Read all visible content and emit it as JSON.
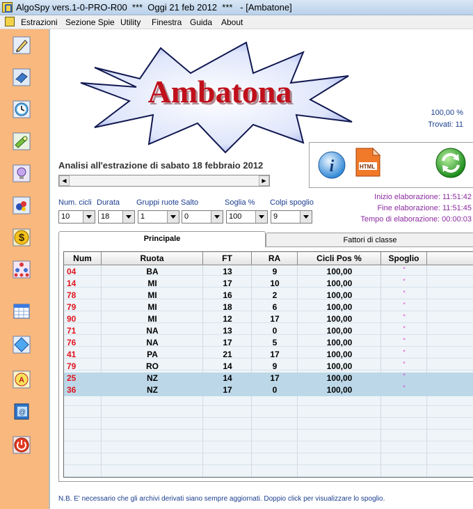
{
  "window": {
    "title": "AlgoSpy vers.1-0-PRO-R00  ***  Oggi 21 feb 2012  ***   - [Ambatone]"
  },
  "menu": [
    "Estrazioni",
    "Sezione Spie",
    "Utility",
    "Finestra",
    "Guida",
    "About"
  ],
  "sidebar": {
    "buttons": [
      "pencil-icon",
      "eraser-icon",
      "clock-icon",
      "flashlight-icon",
      "lightbulb-icon",
      "lottery-balls-icon",
      "dollar-icon",
      "tree-diagram-icon",
      "calendar-icon",
      "diamond-icon",
      "letter-a-icon",
      "address-book-icon",
      "power-icon"
    ]
  },
  "banner": {
    "text": "Ambatona"
  },
  "stats": {
    "percent": "100,00 %",
    "found": "Trovati: 11"
  },
  "analysis": {
    "title": "Analisi all'estrazione di sabato 18 febbraio 2012"
  },
  "actions": {
    "info": "info-icon",
    "html": "HTML",
    "refresh": "refresh-icon"
  },
  "timing": {
    "start": "Inizio elaborazione: 11:51:42",
    "end": "Fine elaborazione: 11:51:45",
    "elapsed": "Tempo di elaborazione: 00:00:03"
  },
  "fields": {
    "num_cicli": {
      "label": "Num. cicli",
      "value": "10"
    },
    "durata": {
      "label": "Durata",
      "value": "18"
    },
    "gruppi_ruote": {
      "label": "Gruppi ruote",
      "value": "1"
    },
    "salto": {
      "label": "Salto",
      "value": "0"
    },
    "soglia": {
      "label": "Soglia %",
      "value": "100"
    },
    "colpi_spoglio": {
      "label": "Colpi spoglio",
      "value": "9"
    }
  },
  "tabs": [
    "Principale",
    "Fattori di classe"
  ],
  "grid": {
    "columns": [
      "Num",
      "Ruota",
      "FT",
      "RA",
      "Cicli Pos %",
      "Spoglio"
    ],
    "rows": [
      {
        "num": "04",
        "ruota": "BA",
        "ft": "13",
        "ra": "9",
        "cicli": "100,00",
        "spoglio": "°"
      },
      {
        "num": "14",
        "ruota": "MI",
        "ft": "17",
        "ra": "10",
        "cicli": "100,00",
        "spoglio": "°"
      },
      {
        "num": "78",
        "ruota": "MI",
        "ft": "16",
        "ra": "2",
        "cicli": "100,00",
        "spoglio": "°"
      },
      {
        "num": "79",
        "ruota": "MI",
        "ft": "18",
        "ra": "6",
        "cicli": "100,00",
        "spoglio": "°"
      },
      {
        "num": "90",
        "ruota": "MI",
        "ft": "12",
        "ra": "17",
        "cicli": "100,00",
        "spoglio": "°"
      },
      {
        "num": "71",
        "ruota": "NA",
        "ft": "13",
        "ra": "0",
        "cicli": "100,00",
        "spoglio": "°"
      },
      {
        "num": "76",
        "ruota": "NA",
        "ft": "17",
        "ra": "5",
        "cicli": "100,00",
        "spoglio": "°"
      },
      {
        "num": "41",
        "ruota": "PA",
        "ft": "21",
        "ra": "17",
        "cicli": "100,00",
        "spoglio": "°"
      },
      {
        "num": "79",
        "ruota": "RO",
        "ft": "14",
        "ra": "9",
        "cicli": "100,00",
        "spoglio": "°"
      },
      {
        "num": "25",
        "ruota": "NZ",
        "ft": "14",
        "ra": "17",
        "cicli": "100,00",
        "spoglio": "°"
      },
      {
        "num": "36",
        "ruota": "NZ",
        "ft": "17",
        "ra": "0",
        "cicli": "100,00",
        "spoglio": "°"
      }
    ]
  },
  "footer": {
    "note": "N.B. E' necessario che gli archivi derivati siano sempre aggiornati. Doppio click per visualizzare lo spoglio."
  },
  "colors": {
    "sidebar_bg": "#f9b87d",
    "number_red": "#e0141e",
    "banner_text": "#c0101c",
    "timing_purple": "#8b2aa0",
    "label_blue": "#1a3d8f"
  }
}
